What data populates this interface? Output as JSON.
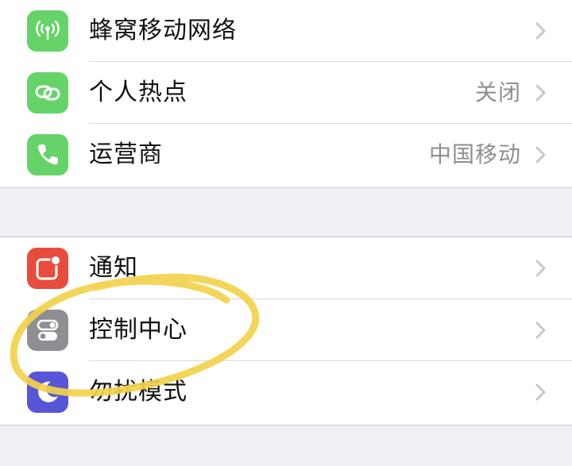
{
  "colors": {
    "cellular_icon_bg": "#65d368",
    "hotspot_icon_bg": "#65d368",
    "carrier_icon_bg": "#65d368",
    "notifications_icon_bg": "#e74c3c",
    "control_center_icon_bg": "#8e8e93",
    "dnd_icon_bg": "#5856d6",
    "highlight_stroke": "#f2d34b"
  },
  "group1": {
    "rows": [
      {
        "label": "蜂窝移动网络",
        "value": "",
        "icon": "cellular-antenna-icon"
      },
      {
        "label": "个人热点",
        "value": "关闭",
        "icon": "personal-hotspot-icon"
      },
      {
        "label": "运营商",
        "value": "中国移动",
        "icon": "phone-icon"
      }
    ]
  },
  "group2": {
    "rows": [
      {
        "label": "通知",
        "value": "",
        "icon": "notifications-icon"
      },
      {
        "label": "控制中心",
        "value": "",
        "icon": "control-center-icon"
      },
      {
        "label": "勿扰模式",
        "value": "",
        "icon": "moon-icon"
      }
    ]
  },
  "annotation": {
    "shape": "hand-drawn-circle",
    "target": "控制中心"
  }
}
